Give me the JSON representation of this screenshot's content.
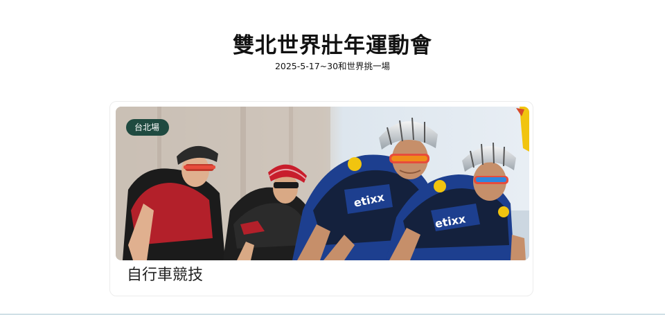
{
  "header": {
    "title": "雙北世界壯年運動會",
    "subtitle": "2025-5-17~30和世界挑一場"
  },
  "card": {
    "badge": "台北場",
    "title": "自行車競技",
    "image_icon": "cycling-race-photo"
  },
  "colors": {
    "badge_bg": "#1f4a40",
    "divider": "#cfe0e6",
    "jersey_blue": "#1d3f8f",
    "jersey_red": "#b3202a"
  }
}
